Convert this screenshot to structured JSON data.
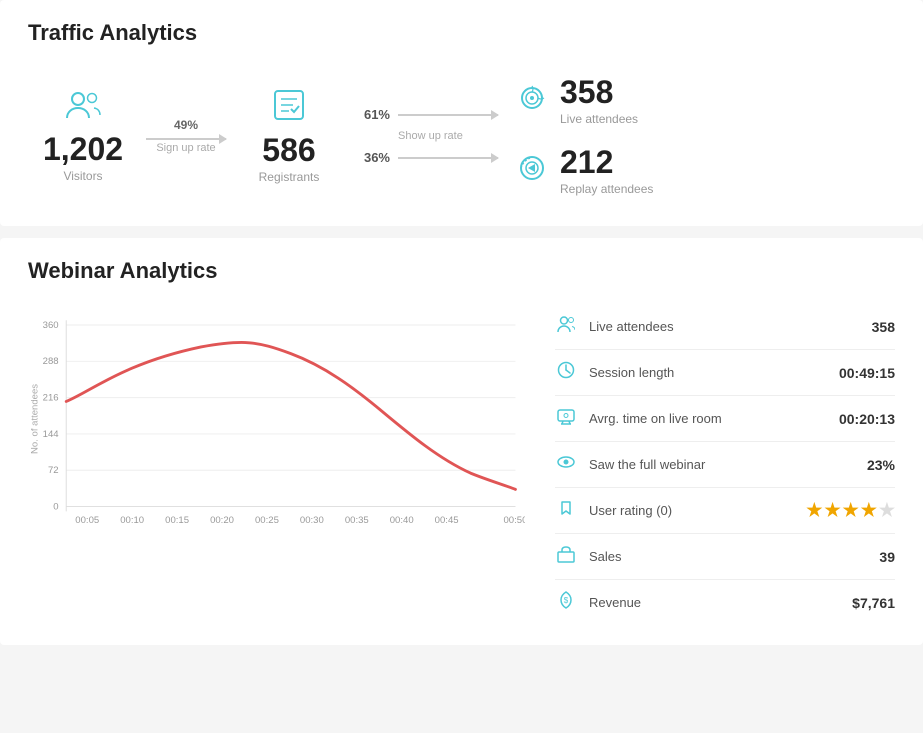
{
  "page": {
    "background": "#f5f5f5"
  },
  "traffic": {
    "title": "Traffic Analytics",
    "visitors": {
      "value": "1,202",
      "label": "Visitors",
      "icon": "👥"
    },
    "signup_arrow": {
      "pct": "49%",
      "label": "Sign up rate"
    },
    "registrants": {
      "value": "586",
      "label": "Registrants",
      "icon": "☑"
    },
    "show_up_label": "Show up rate",
    "upper_pct": "61%",
    "lower_pct": "36%",
    "live_attendees": {
      "value": "358",
      "label": "Live attendees"
    },
    "replay_attendees": {
      "value": "212",
      "label": "Replay attendees"
    }
  },
  "webinar": {
    "title": "Webinar Analytics",
    "stats": [
      {
        "icon": "👥",
        "name": "Live attendees",
        "value": "358"
      },
      {
        "icon": "🕐",
        "name": "Session length",
        "value": "00:49:15"
      },
      {
        "icon": "🖥",
        "name": "Avrg. time on live room",
        "value": "00:20:13"
      },
      {
        "icon": "👁",
        "name": "Saw the full webinar",
        "value": "23%"
      },
      {
        "icon": "👍",
        "name": "User rating (0)",
        "value": "stars"
      },
      {
        "icon": "🛒",
        "name": "Sales",
        "value": "39"
      },
      {
        "icon": "💰",
        "name": "Revenue",
        "value": "$7,761"
      }
    ],
    "chart": {
      "y_max": 360,
      "y_labels": [
        360,
        288,
        216,
        144,
        72,
        0
      ],
      "x_labels": [
        "00:05",
        "00:10",
        "00:15",
        "00:20",
        "00:25",
        "00:30",
        "00:35",
        "00:40",
        "00:45",
        "00:50"
      ],
      "y_axis_title": "No. of attendees"
    },
    "stars": [
      true,
      true,
      true,
      true,
      false
    ]
  }
}
